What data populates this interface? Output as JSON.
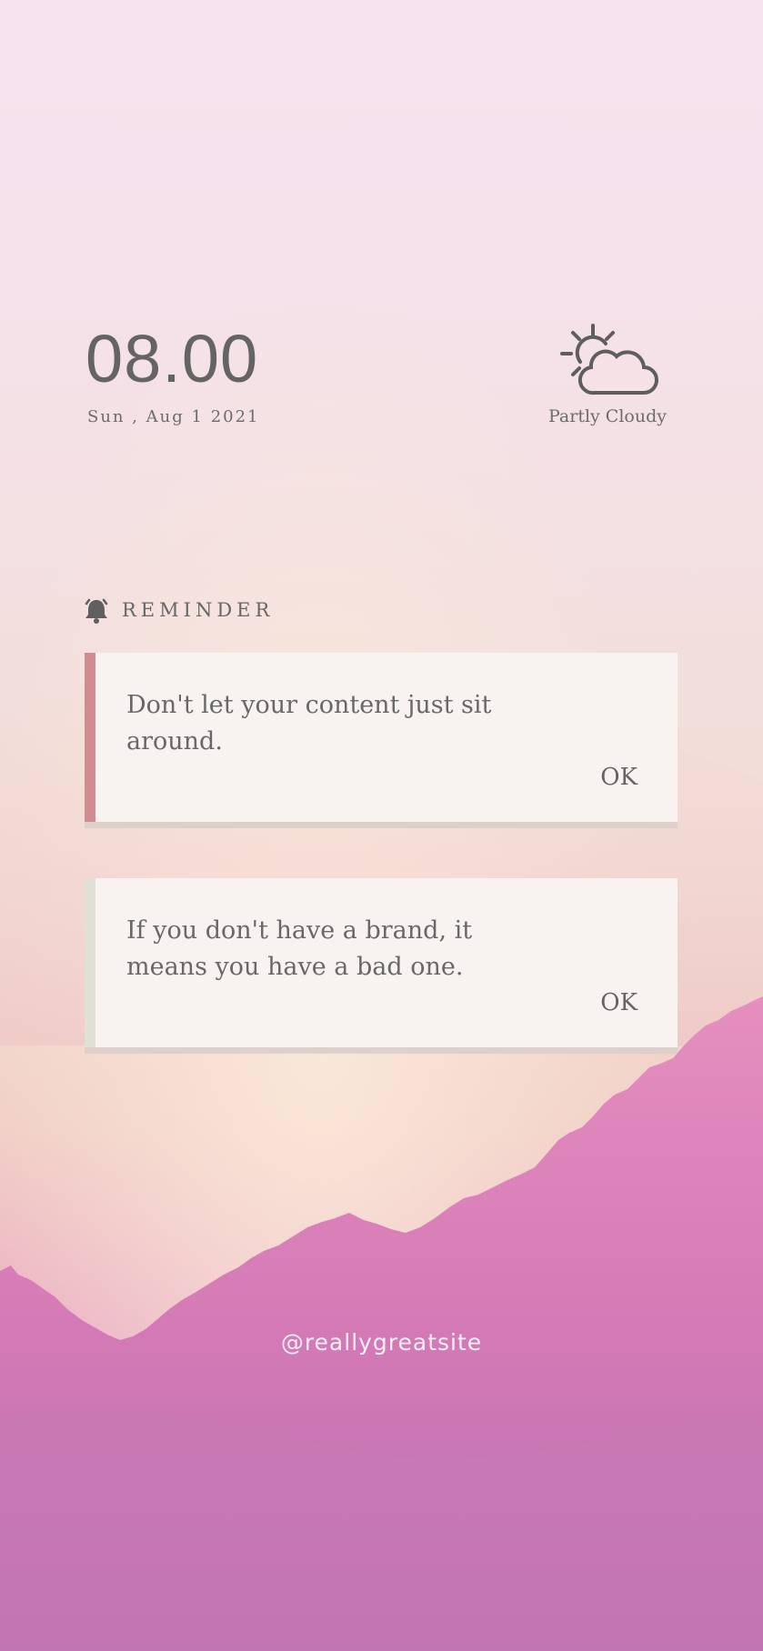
{
  "lockscreen": {
    "time": "08.00",
    "date": "Sun , Aug 1 2021"
  },
  "weather": {
    "icon": "partly-cloudy-icon",
    "label": "Partly Cloudy"
  },
  "reminder": {
    "icon": "bell-icon",
    "title": "REMINDER",
    "cards": [
      {
        "text": "Don't let your content just sit around.",
        "ok_label": "OK",
        "accent": "#d08c8f"
      },
      {
        "text": "If you don't have a brand, it means you have a bad one.",
        "ok_label": "OK",
        "accent": "#e1e0d4"
      }
    ]
  },
  "footer": {
    "handle": "@reallygreatsite"
  },
  "colors": {
    "text": "#646464",
    "card_bg": "#f8f3f1",
    "card_shadow": "#ddcfc9",
    "handle_text": "#fbeef5"
  }
}
